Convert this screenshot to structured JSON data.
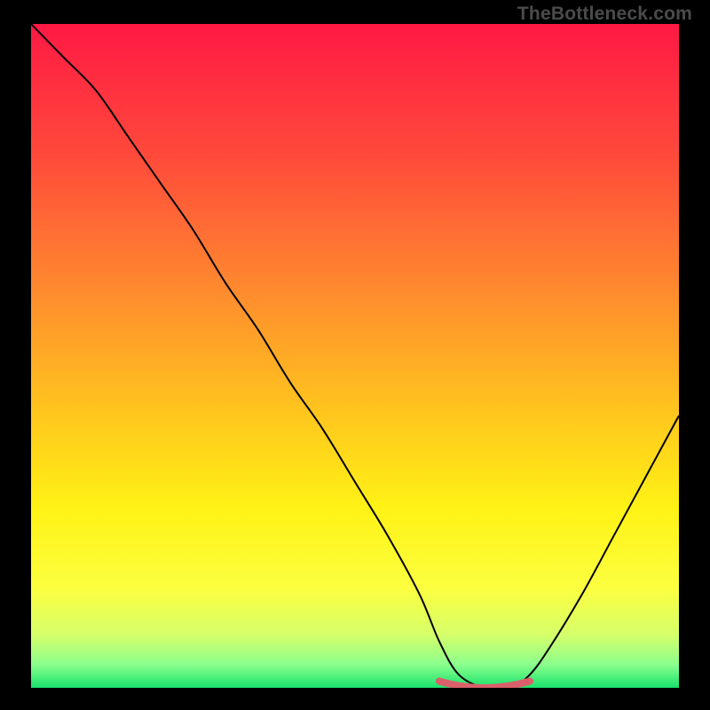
{
  "watermark": "TheBottleneck.com",
  "chart_data": {
    "type": "line",
    "title": "",
    "xlabel": "",
    "ylabel": "",
    "xlim": [
      0,
      100
    ],
    "ylim": [
      0,
      100
    ],
    "series": [
      {
        "name": "curve",
        "x": [
          0,
          5,
          10,
          15,
          20,
          25,
          30,
          35,
          40,
          45,
          50,
          55,
          60,
          63,
          66,
          70,
          74,
          77,
          80,
          85,
          90,
          95,
          100
        ],
        "y": [
          100,
          95,
          90,
          83,
          76,
          69,
          61,
          54,
          46,
          39,
          31,
          23,
          14,
          7,
          2,
          0,
          0,
          2,
          6,
          14,
          23,
          32,
          41
        ]
      },
      {
        "name": "trough-highlight",
        "x": [
          63,
          77
        ],
        "y": [
          1.0,
          1.0
        ]
      }
    ],
    "gradient_stops": [
      {
        "offset": 0.0,
        "color": "#ff1944"
      },
      {
        "offset": 0.2,
        "color": "#ff4a3b"
      },
      {
        "offset": 0.4,
        "color": "#ff8a2e"
      },
      {
        "offset": 0.58,
        "color": "#ffc41e"
      },
      {
        "offset": 0.73,
        "color": "#fff215"
      },
      {
        "offset": 0.85,
        "color": "#fcff40"
      },
      {
        "offset": 0.92,
        "color": "#d6ff6a"
      },
      {
        "offset": 0.965,
        "color": "#8bff8d"
      },
      {
        "offset": 1.0,
        "color": "#19e26c"
      }
    ],
    "colors": {
      "curve_stroke": "#000000",
      "trough_stroke": "#d9606a"
    }
  }
}
